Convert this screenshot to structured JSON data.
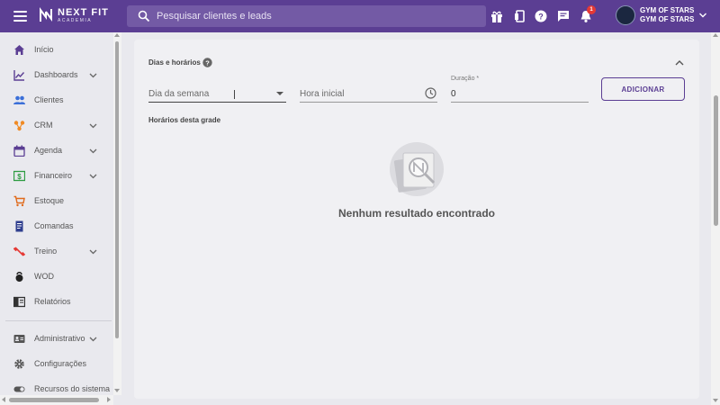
{
  "header": {
    "logo_name": "NEXT FIT",
    "logo_sub": "ACADEMIA",
    "search_placeholder": "Pesquisar clientes e leads",
    "notification_count": "1",
    "account_line1": "GYM OF STARS",
    "account_line2": "GYM OF STARS",
    "icons": [
      "gift-icon",
      "phone-icon",
      "help-icon",
      "chat-icon",
      "bell-icon"
    ]
  },
  "sidebar": {
    "items": [
      {
        "label": "Início",
        "icon": "home-icon",
        "color": "#5b3e93",
        "expandable": false
      },
      {
        "label": "Dashboards",
        "icon": "chart-line-icon",
        "color": "#5b3e93",
        "expandable": true
      },
      {
        "label": "Clientes",
        "icon": "people-icon",
        "color": "#3b6fd8",
        "expandable": false
      },
      {
        "label": "CRM",
        "icon": "crm-icon",
        "color": "#f08a24",
        "expandable": true
      },
      {
        "label": "Agenda",
        "icon": "calendar-icon",
        "color": "#5b3e93",
        "expandable": true
      },
      {
        "label": "Financeiro",
        "icon": "money-icon",
        "color": "#2e9c42",
        "expandable": true
      },
      {
        "label": "Estoque",
        "icon": "cart-icon",
        "color": "#e06a1b",
        "expandable": false
      },
      {
        "label": "Comandas",
        "icon": "receipt-icon",
        "color": "#2f3e8f",
        "expandable": false
      },
      {
        "label": "Treino",
        "icon": "dumbbell-icon",
        "color": "#e53935",
        "expandable": true
      },
      {
        "label": "WOD",
        "icon": "kettlebell-icon",
        "color": "#222222",
        "expandable": false
      },
      {
        "label": "Relatórios",
        "icon": "report-icon",
        "color": "#333333",
        "expandable": false
      },
      {
        "label": "Administrativo",
        "icon": "id-card-icon",
        "color": "#555555",
        "expandable": true
      },
      {
        "label": "Configurações",
        "icon": "gear-icon",
        "color": "#555555",
        "expandable": false
      },
      {
        "label": "Recursos do sistema",
        "icon": "toggle-icon",
        "color": "#555555",
        "expandable": false
      }
    ]
  },
  "main": {
    "section_title": "Dias e horários",
    "weekday_placeholder": "Dia da semana",
    "start_time_placeholder": "Hora inicial",
    "duration_label": "Duração *",
    "duration_value": "0",
    "add_button": "ADICIONAR",
    "schedule_title": "Horários desta grade",
    "empty_message": "Nenhum resultado encontrado"
  },
  "colors": {
    "brand": "#5b3e93",
    "background": "#e9e9ee",
    "card": "#f0f0f3"
  }
}
